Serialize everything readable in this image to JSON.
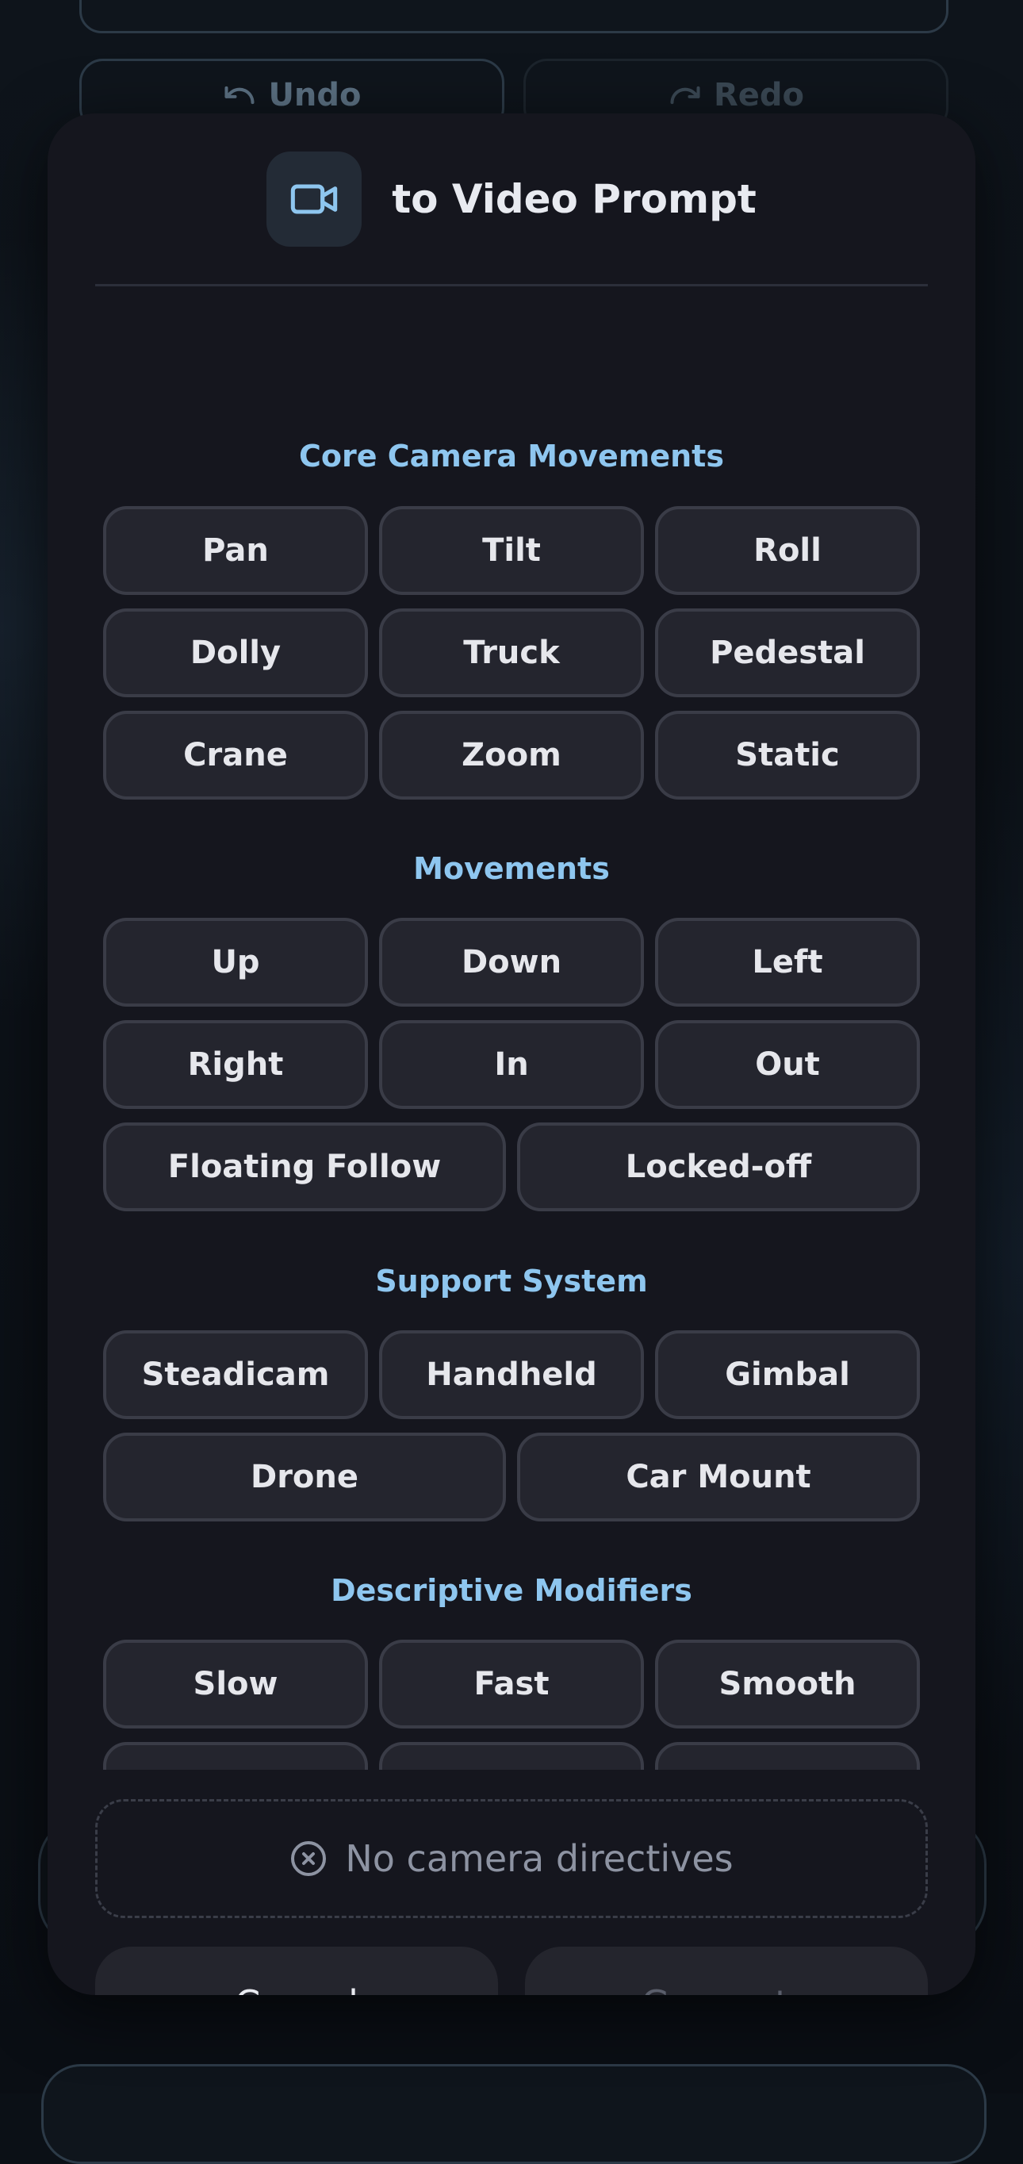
{
  "background": {
    "undo_label": "Undo",
    "redo_label": "Redo"
  },
  "modal": {
    "title": "to Video Prompt",
    "icon": "video-camera-icon",
    "accent_color": "#8ec6ef",
    "sections": [
      {
        "title": "Core Camera Movements",
        "options": [
          "Pan",
          "Tilt",
          "Roll",
          "Dolly",
          "Truck",
          "Pedestal",
          "Crane",
          "Zoom",
          "Static"
        ]
      },
      {
        "title": "Movements",
        "options": [
          "Up",
          "Down",
          "Left",
          "Right",
          "In",
          "Out",
          "Floating Follow",
          "Locked-off"
        ]
      },
      {
        "title": "Support System",
        "options": [
          "Steadicam",
          "Handheld",
          "Gimbal",
          "Drone",
          "Car Mount"
        ]
      },
      {
        "title": "Descriptive Modifiers",
        "options": [
          "Slow",
          "Fast",
          "Smooth"
        ]
      }
    ],
    "status_text": "No camera directives",
    "cancel_label": "Cancel",
    "generate_label": "Generate"
  }
}
